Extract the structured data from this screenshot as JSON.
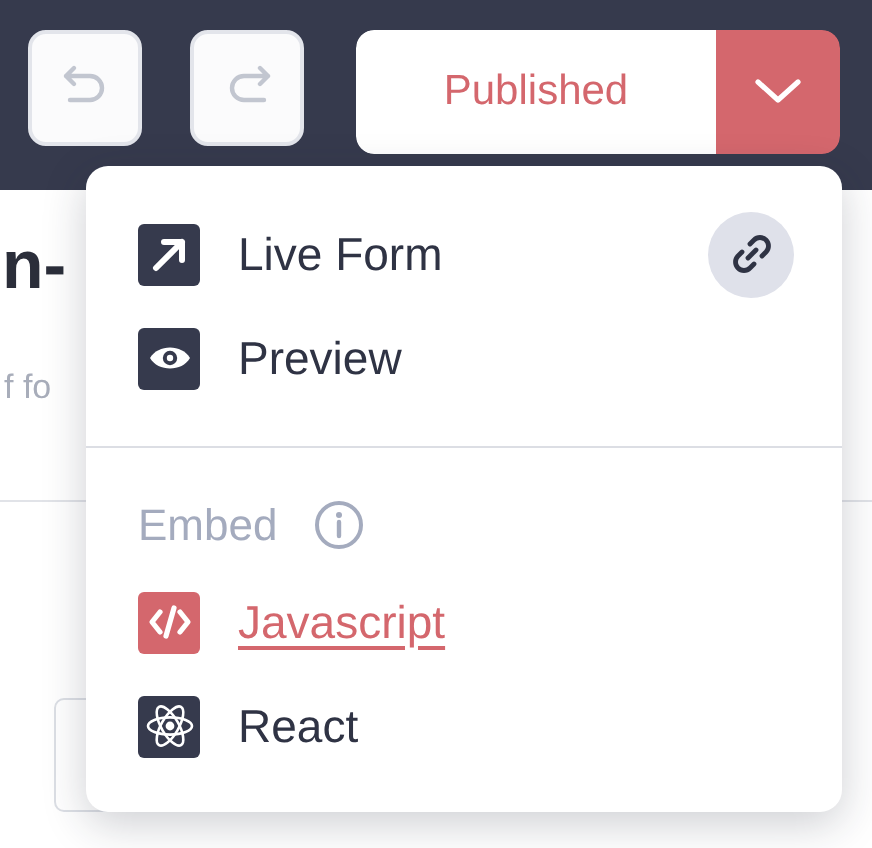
{
  "page": {
    "title_fragment": "n-",
    "subtitle_fragment": "f fo"
  },
  "toolbar": {
    "publish_button": {
      "label": "Published"
    }
  },
  "menu": {
    "items": [
      {
        "label": "Live Form",
        "kind": "live"
      },
      {
        "label": "Preview",
        "kind": "preview"
      }
    ],
    "embed": {
      "heading": "Embed",
      "options": [
        {
          "label": "Javascript",
          "kind": "javascript",
          "selected": true
        },
        {
          "label": "React",
          "kind": "react",
          "selected": false
        }
      ]
    }
  }
}
